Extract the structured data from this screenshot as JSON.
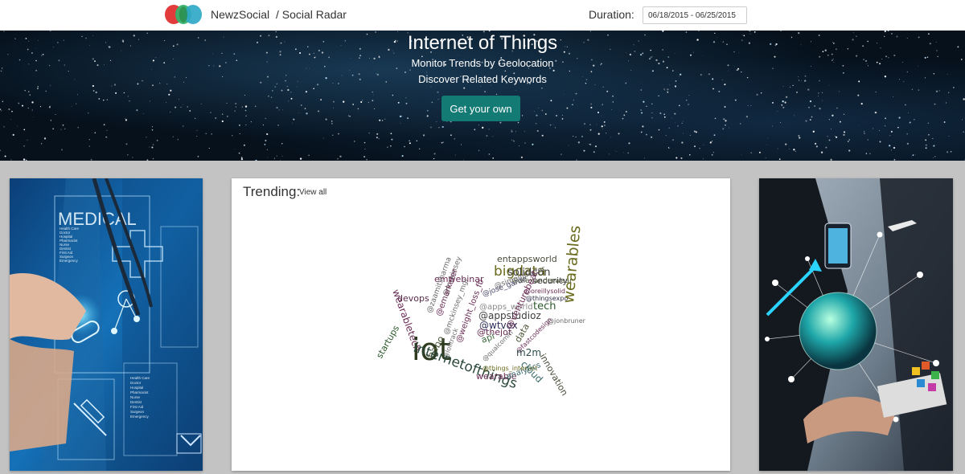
{
  "header": {
    "brand": "NewzSocial",
    "breadcrumb": "/ Social Radar",
    "duration_label": "Duration:",
    "duration_value": "06/18/2015 - 06/25/2015"
  },
  "hero": {
    "title": "Internet of Things",
    "subtitle1": "Monitor Trends by Geolocation",
    "subtitle2": "Discover Related Keywords",
    "cta_label": "Get your own"
  },
  "trending": {
    "title": "Trending:",
    "view_all": "View all",
    "words": [
      {
        "text": "entappsworld",
        "color": "#4a4a3a"
      },
      {
        "text": "bigdata",
        "color": "#6b6b1e"
      },
      {
        "text": "solidcon",
        "color": "#3d3d3d"
      },
      {
        "text": "emwebinar",
        "color": "#6a2d55"
      },
      {
        "text": "@alexanderwear",
        "color": "#4f5a3a"
      },
      {
        "text": "security",
        "color": "#3d3d3d"
      },
      {
        "text": "@simonlporter",
        "color": "#6b6b6b"
      },
      {
        "text": "@jose_garde",
        "color": "#4a4a6a"
      },
      {
        "text": "@oreillysolid",
        "color": "#6a2d55"
      },
      {
        "text": "@thingsexpo",
        "color": "#2d2d4a"
      },
      {
        "text": "wearabletech",
        "color": "#6a2d55"
      },
      {
        "text": "devops",
        "color": "#5a2a4a"
      },
      {
        "text": "@mckinsey",
        "color": "#6b6b6b"
      },
      {
        "text": "@zaamitsharma",
        "color": "#6b6b6b"
      },
      {
        "text": "@apps_world",
        "color": "#8a8a8a"
      },
      {
        "text": "tech",
        "color": "#2d5a2d"
      },
      {
        "text": "wearables",
        "color": "#6b6b1e"
      },
      {
        "text": "@appstudioz",
        "color": "#3d3d3d"
      },
      {
        "text": "@jonbruner",
        "color": "#6b6b6b"
      },
      {
        "text": "@wtvox",
        "color": "#2d2d5a"
      },
      {
        "text": "@emarketer",
        "color": "#6a2d55"
      },
      {
        "text": "@mckinsey_mgi",
        "color": "#6b6b6b"
      },
      {
        "text": "@thejot",
        "color": "#6a2d55"
      },
      {
        "text": "@venturebeat",
        "color": "#6a2d55"
      },
      {
        "text": "iot",
        "color": "#2d3a1e"
      },
      {
        "text": "startups",
        "color": "#2d5a2d"
      },
      {
        "text": "habo",
        "color": "#4f5a3a"
      },
      {
        "text": "@weight_loss_fb",
        "color": "#6a2d55"
      },
      {
        "text": "@qualcomm",
        "color": "#6b6b6b"
      },
      {
        "text": "api",
        "color": "#3d6b3d"
      },
      {
        "text": "data",
        "color": "#4f5a3a"
      },
      {
        "text": "@fastcodesign",
        "color": "#6a2d55"
      },
      {
        "text": "innovation",
        "color": "#4a4a3a"
      },
      {
        "text": "m2m",
        "color": "#2d4a4a"
      },
      {
        "text": "cloud",
        "color": "#3d6b6b"
      },
      {
        "text": "@lolltrack",
        "color": "#6b6b6b"
      },
      {
        "text": "internetofthings",
        "color": "#2d4a3d"
      },
      {
        "text": "@things_internet",
        "color": "#6b6b1e"
      },
      {
        "text": "wearable",
        "color": "#6a2d55"
      },
      {
        "text": "analytics",
        "color": "#3d6b6b"
      }
    ]
  },
  "left_image": {
    "title": "MEDICAL",
    "list1": [
      "Health Care",
      "Doctor",
      "Hospital",
      "Pharmacist",
      "Nurse",
      "Dentist",
      "First Aid",
      "Surgeon",
      "Emergency"
    ],
    "list2": [
      "Health Care",
      "Doctor",
      "Hospital",
      "Pharmacist",
      "Nurse",
      "Dentist",
      "First Aid",
      "Surgeon",
      "Emergency"
    ]
  }
}
